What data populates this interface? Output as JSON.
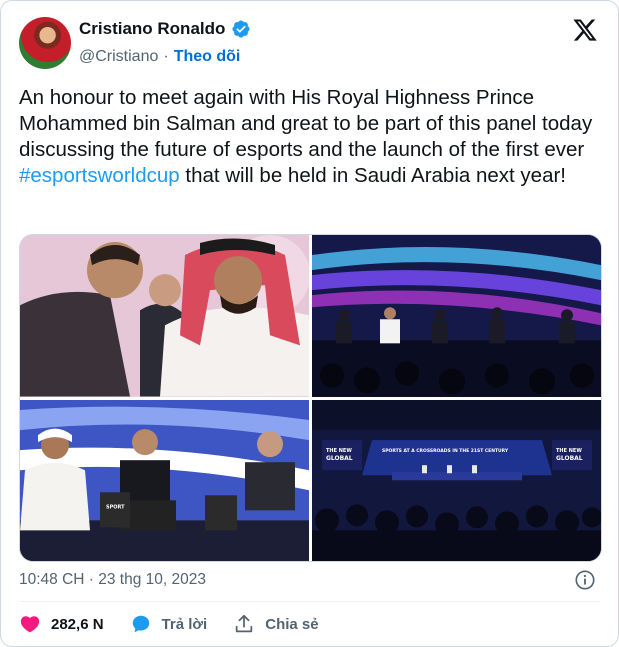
{
  "author": {
    "name": "Cristiano Ronaldo",
    "handle": "@Cristiano",
    "separator": "·",
    "follow_label": "Theo dõi"
  },
  "tweet": {
    "text_before": "An honour to meet again with His Royal Highness Prince Mohammed bin Salman and great to be part of this panel today discussing the future of esports and the launch of the first ever ",
    "hashtag": "#esportsworldcup",
    "text_after": " that will be held in Saudi Arabia next year!"
  },
  "media": {
    "photo_count": 4,
    "panel_banner": "SPORTS AT A CROSSROADS IN THE 21ST CENTURY",
    "logo_line1": "THE NEW",
    "logo_line2": "GLOBAL",
    "logo_line3": "SPORT"
  },
  "timestamp": "10:48 CH · 23 thg 10, 2023",
  "actions": {
    "likes": "282,6 N",
    "reply_label": "Trả lời",
    "share_label": "Chia sẻ"
  },
  "colors": {
    "accent": "#1d9bf0",
    "follow": "#006fd6",
    "like": "#f91880",
    "muted": "#536471"
  },
  "icons": [
    "verified-badge-icon",
    "x-logo-icon",
    "info-icon",
    "heart-icon",
    "reply-bubble-icon",
    "share-icon"
  ]
}
